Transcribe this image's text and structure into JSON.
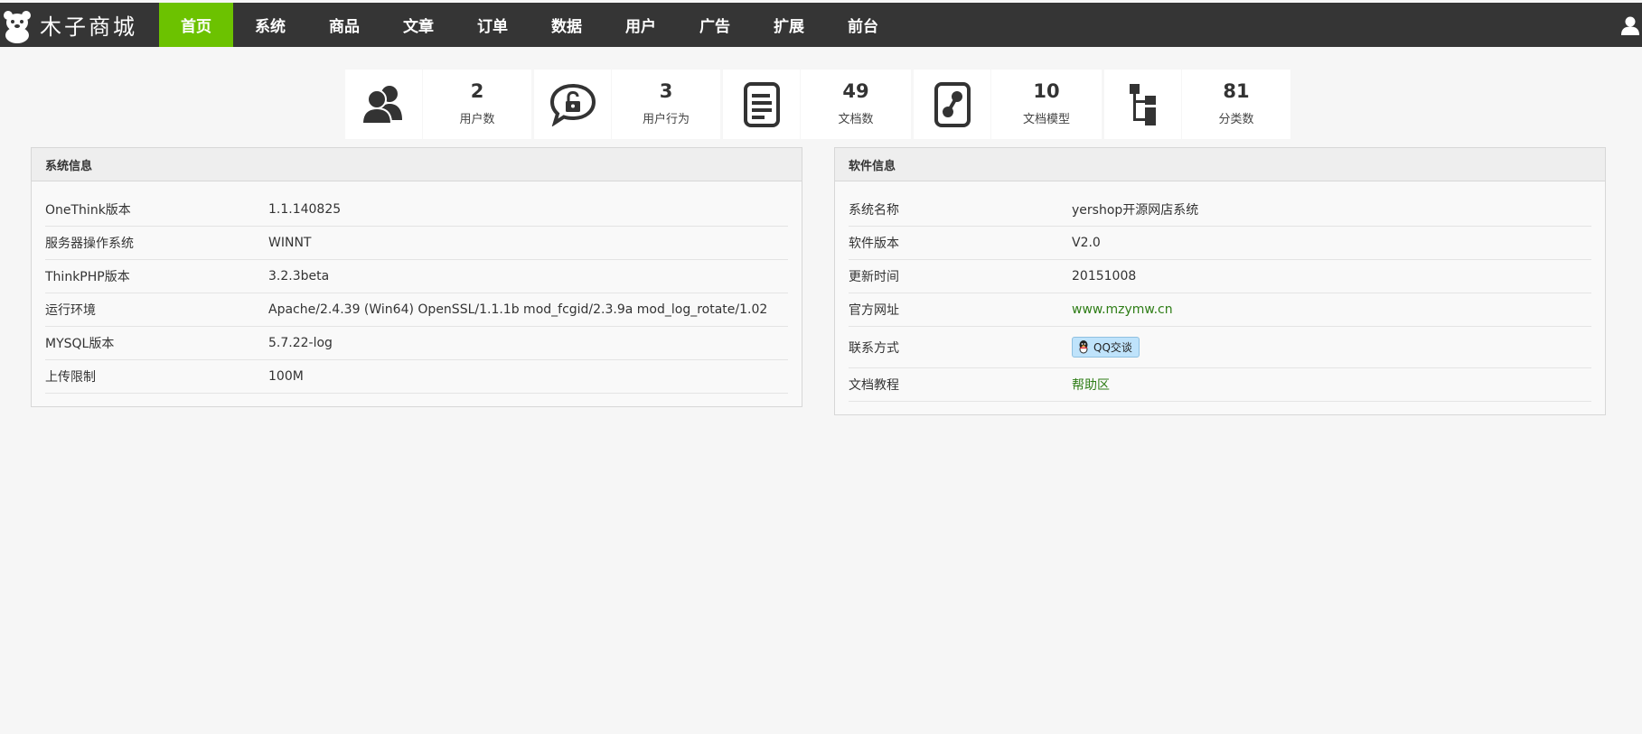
{
  "brand": {
    "name": "木子商城"
  },
  "nav": {
    "items": [
      {
        "label": "首页"
      },
      {
        "label": "系统"
      },
      {
        "label": "商品"
      },
      {
        "label": "文章"
      },
      {
        "label": "订单"
      },
      {
        "label": "数据"
      },
      {
        "label": "用户"
      },
      {
        "label": "广告"
      },
      {
        "label": "扩展"
      },
      {
        "label": "前台"
      }
    ],
    "active_color": "#6cc200"
  },
  "stats": [
    {
      "value": "2",
      "label": "用户数",
      "icon": "users-icon"
    },
    {
      "value": "3",
      "label": "用户行为",
      "icon": "chat-lock-icon"
    },
    {
      "value": "49",
      "label": "文档数",
      "icon": "document-icon"
    },
    {
      "value": "10",
      "label": "文档模型",
      "icon": "document-model-icon"
    },
    {
      "value": "81",
      "label": "分类数",
      "icon": "tree-icon"
    }
  ],
  "system_info": {
    "title": "系统信息",
    "rows": [
      {
        "label": "OneThink版本",
        "value": "1.1.140825"
      },
      {
        "label": "服务器操作系统",
        "value": "WINNT"
      },
      {
        "label": "ThinkPHP版本",
        "value": "3.2.3beta"
      },
      {
        "label": "运行环境",
        "value": "Apache/2.4.39 (Win64) OpenSSL/1.1.1b mod_fcgid/2.3.9a mod_log_rotate/1.02"
      },
      {
        "label": "MYSQL版本",
        "value": "5.7.22-log"
      },
      {
        "label": "上传限制",
        "value": "100M"
      }
    ]
  },
  "software_info": {
    "title": "软件信息",
    "rows": [
      {
        "label": "系统名称",
        "value": "yershop开源网店系统"
      },
      {
        "label": "软件版本",
        "value": "V2.0"
      },
      {
        "label": "更新时间",
        "value": "20151008"
      },
      {
        "label": "官方网址",
        "value": "www.mzymw.cn"
      },
      {
        "label": "联系方式",
        "value": "QQ交谈"
      },
      {
        "label": "文档教程",
        "value": "帮助区"
      }
    ]
  },
  "colors": {
    "topbar": "#353535",
    "accent": "#6cc200",
    "link": "#2e7d16"
  }
}
